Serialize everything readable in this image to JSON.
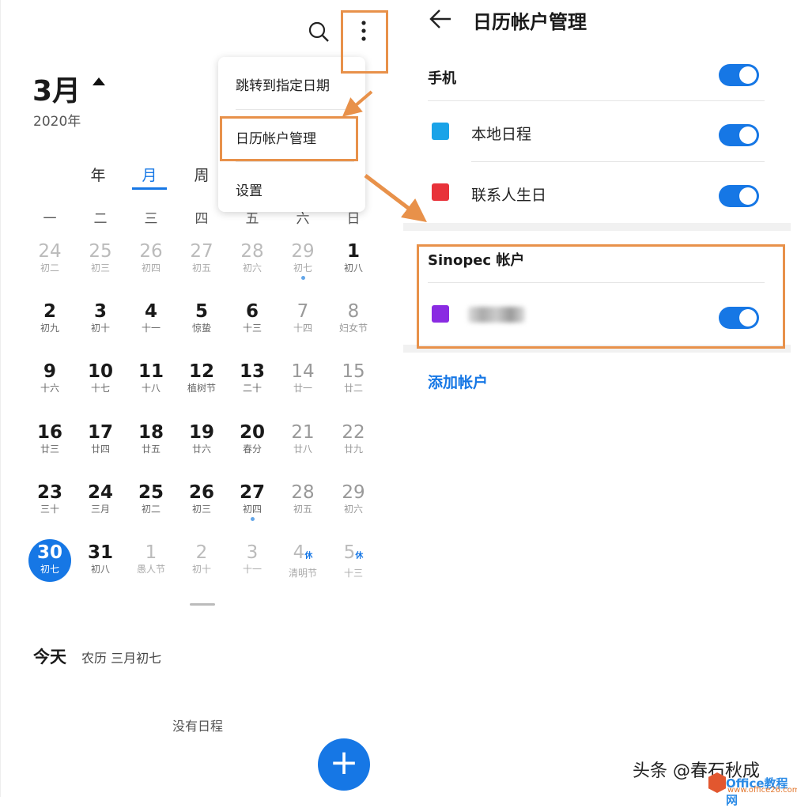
{
  "left": {
    "month": "3月",
    "year": "2020年",
    "views": [
      "年",
      "月",
      "周"
    ],
    "active_view": "月",
    "weekdays": [
      "一",
      "二",
      "三",
      "四",
      "五",
      "六",
      "日"
    ],
    "weeks": [
      [
        {
          "d": "24",
          "l": "初二",
          "s": "o"
        },
        {
          "d": "25",
          "l": "初三",
          "s": "o"
        },
        {
          "d": "26",
          "l": "初四",
          "s": "o"
        },
        {
          "d": "27",
          "l": "初五",
          "s": "o"
        },
        {
          "d": "28",
          "l": "初六",
          "s": "o"
        },
        {
          "d": "29",
          "l": "初七",
          "s": "o",
          "dot": true
        },
        {
          "d": "1",
          "l": "初八",
          "s": "n"
        }
      ],
      [
        {
          "d": "2",
          "l": "初九",
          "s": "n"
        },
        {
          "d": "3",
          "l": "初十",
          "s": "n"
        },
        {
          "d": "4",
          "l": "十一",
          "s": "n"
        },
        {
          "d": "5",
          "l": "惊蛰",
          "s": "n"
        },
        {
          "d": "6",
          "l": "十三",
          "s": "n"
        },
        {
          "d": "7",
          "l": "十四",
          "s": "g"
        },
        {
          "d": "8",
          "l": "妇女节",
          "s": "g"
        }
      ],
      [
        {
          "d": "9",
          "l": "十六",
          "s": "n"
        },
        {
          "d": "10",
          "l": "十七",
          "s": "n"
        },
        {
          "d": "11",
          "l": "十八",
          "s": "n"
        },
        {
          "d": "12",
          "l": "植树节",
          "s": "n"
        },
        {
          "d": "13",
          "l": "二十",
          "s": "n"
        },
        {
          "d": "14",
          "l": "廿一",
          "s": "g"
        },
        {
          "d": "15",
          "l": "廿二",
          "s": "g"
        }
      ],
      [
        {
          "d": "16",
          "l": "廿三",
          "s": "n"
        },
        {
          "d": "17",
          "l": "廿四",
          "s": "n"
        },
        {
          "d": "18",
          "l": "廿五",
          "s": "n"
        },
        {
          "d": "19",
          "l": "廿六",
          "s": "n"
        },
        {
          "d": "20",
          "l": "春分",
          "s": "n"
        },
        {
          "d": "21",
          "l": "廿八",
          "s": "g"
        },
        {
          "d": "22",
          "l": "廿九",
          "s": "g"
        }
      ],
      [
        {
          "d": "23",
          "l": "三十",
          "s": "n"
        },
        {
          "d": "24",
          "l": "三月",
          "s": "n"
        },
        {
          "d": "25",
          "l": "初二",
          "s": "n"
        },
        {
          "d": "26",
          "l": "初三",
          "s": "n"
        },
        {
          "d": "27",
          "l": "初四",
          "s": "n",
          "dot": true
        },
        {
          "d": "28",
          "l": "初五",
          "s": "g"
        },
        {
          "d": "29",
          "l": "初六",
          "s": "g"
        }
      ],
      [
        {
          "d": "30",
          "l": "初七",
          "s": "t"
        },
        {
          "d": "31",
          "l": "初八",
          "s": "n"
        },
        {
          "d": "1",
          "l": "愚人节",
          "s": "o"
        },
        {
          "d": "2",
          "l": "初十",
          "s": "o"
        },
        {
          "d": "3",
          "l": "十一",
          "s": "o"
        },
        {
          "d": "4",
          "l": "清明节",
          "s": "o",
          "x": "休"
        },
        {
          "d": "5",
          "l": "十三",
          "s": "o",
          "x": "休"
        }
      ]
    ],
    "today_label": "今天",
    "today_lunar": "农历 三月初七",
    "no_events": "没有日程",
    "fab_icon": "plus-icon"
  },
  "menu": {
    "items": [
      "跳转到指定日期",
      "日历帐户管理",
      "设置"
    ]
  },
  "right": {
    "title": "日历帐户管理",
    "phone_section": "手机",
    "phone_items": [
      {
        "label": "本地日程",
        "color": "#1aa3e8",
        "on": true
      },
      {
        "label": "联系人生日",
        "color": "#e8323a",
        "on": true
      }
    ],
    "sinopec_section": "Sinopec 帐户",
    "sinopec_items": [
      {
        "color": "#8a2be2",
        "on": true
      }
    ],
    "add_account": "添加帐户"
  },
  "colors": {
    "accent": "#1677e5",
    "highlight": "#e8914a"
  },
  "watermark": {
    "text": "头条 @春石秋成",
    "site": "Office教程网",
    "url": "www.office26.com"
  }
}
